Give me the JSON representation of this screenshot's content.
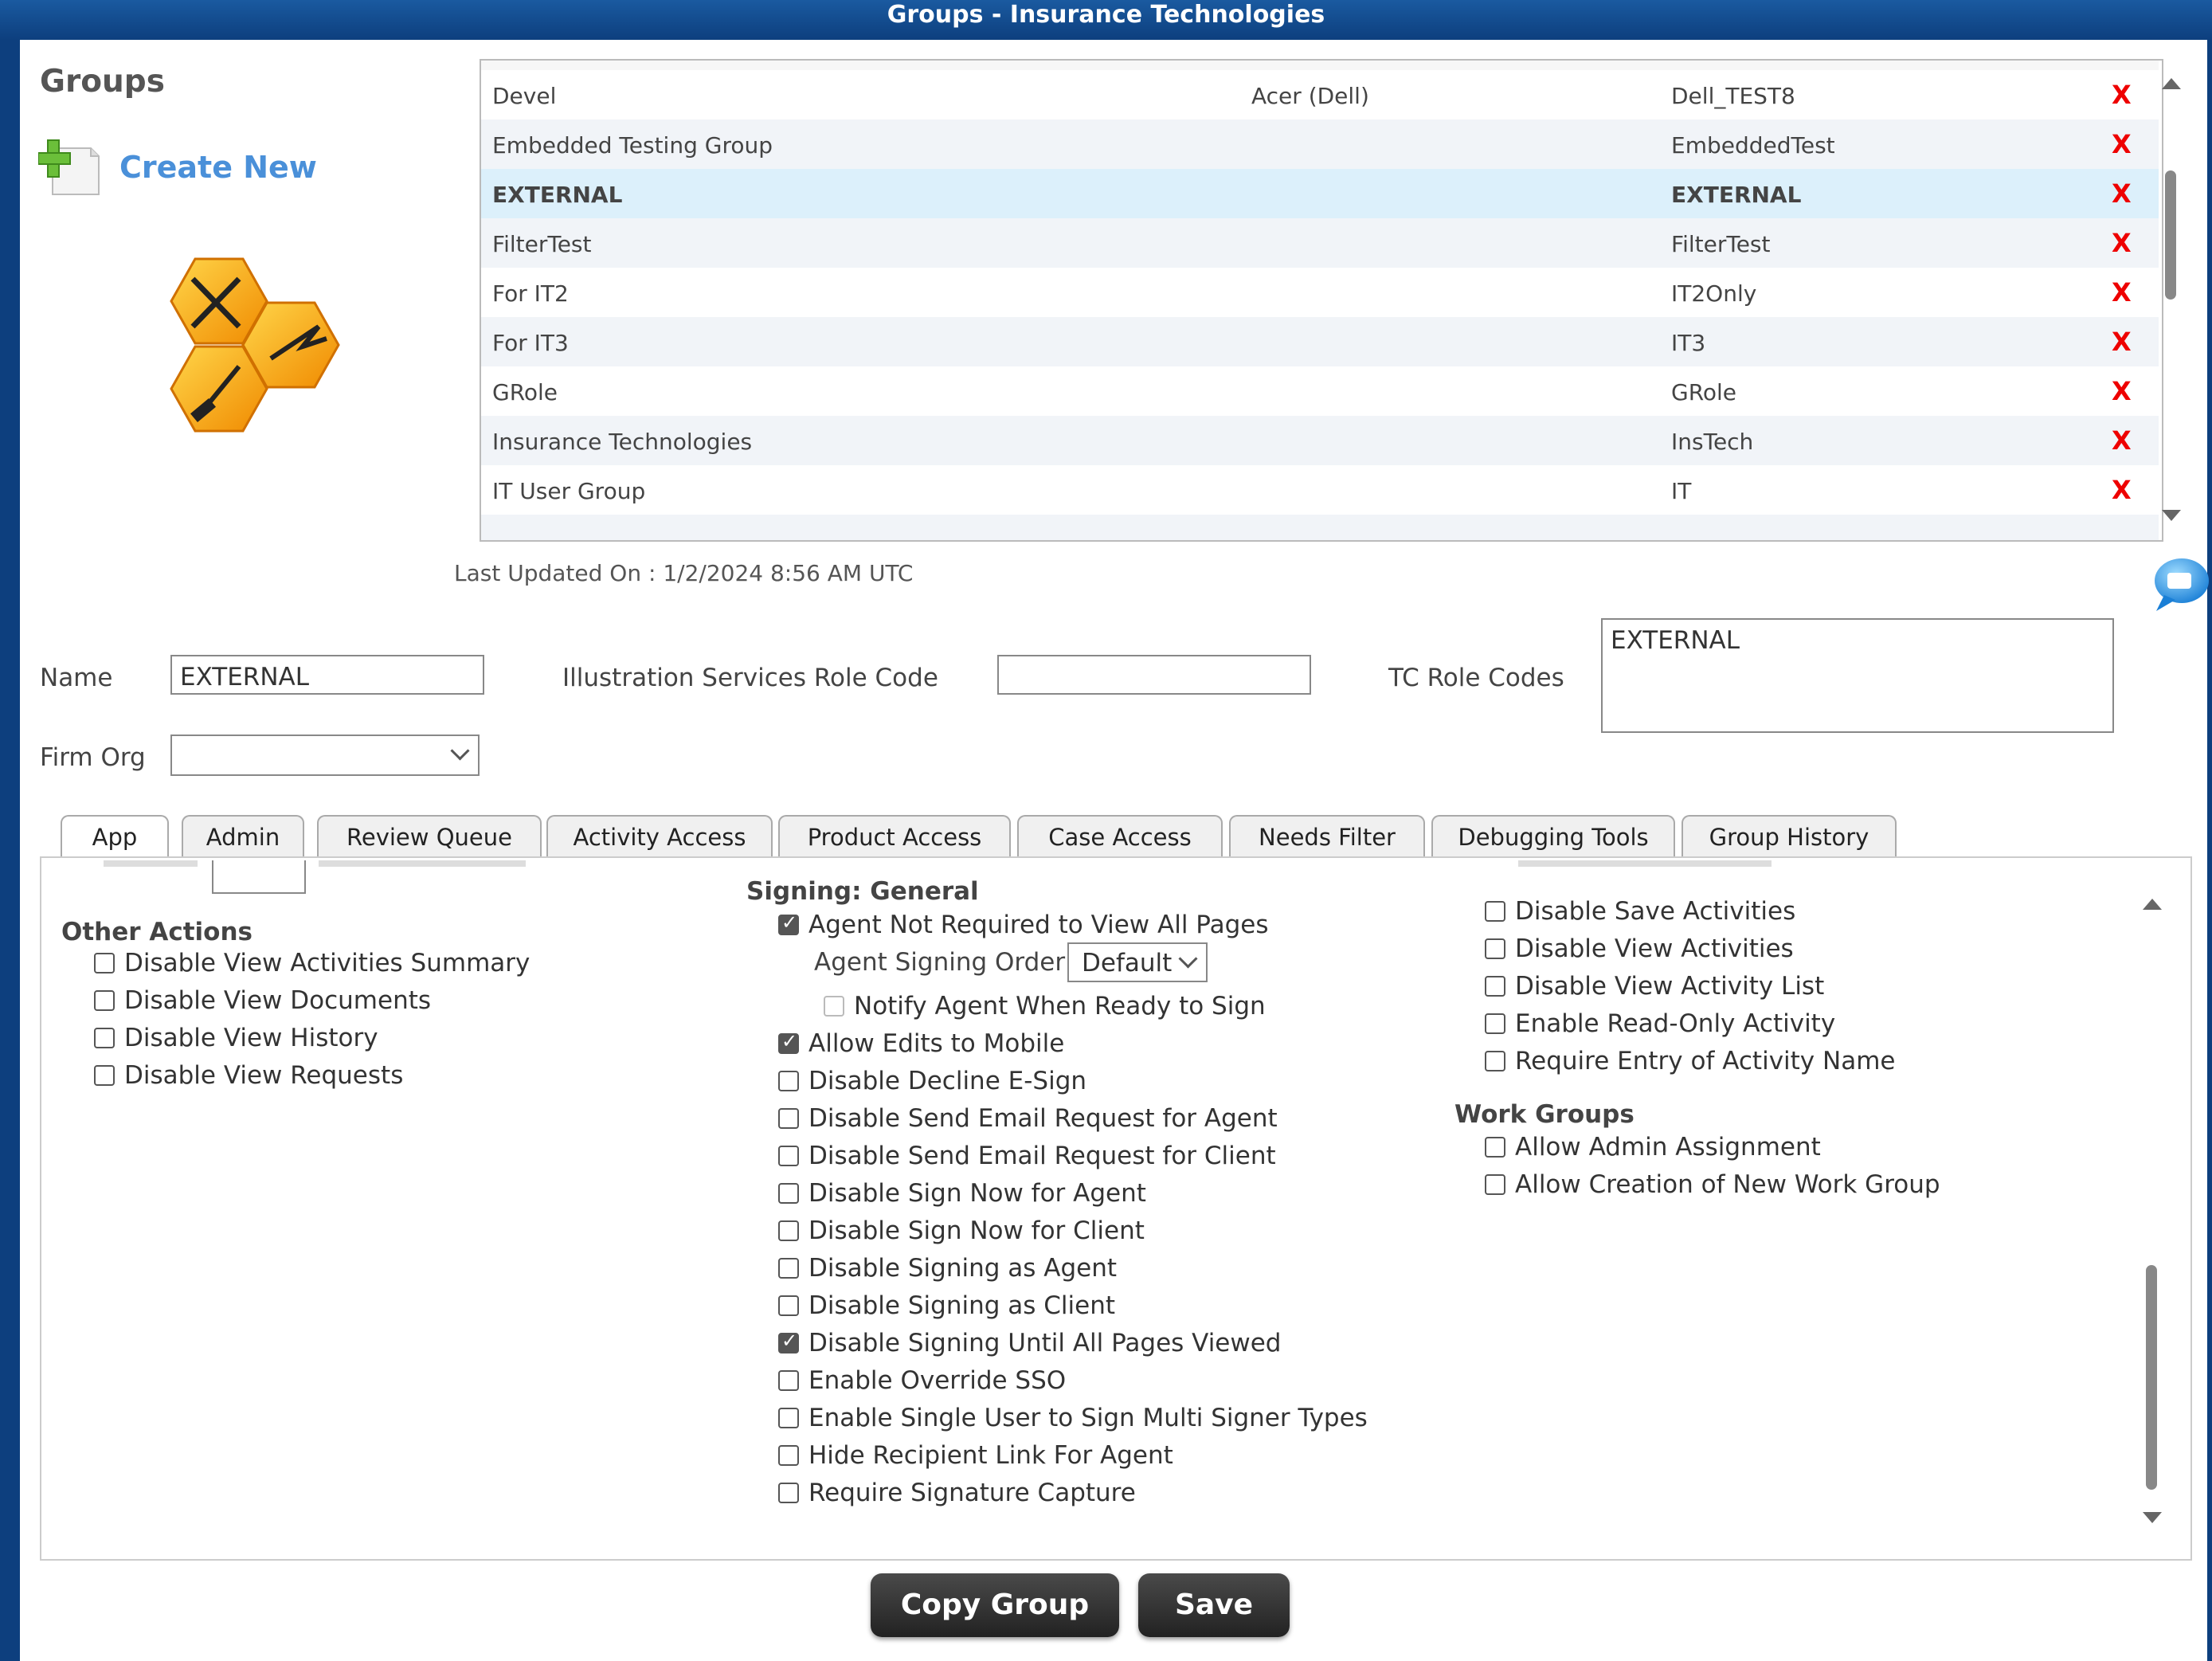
{
  "window": {
    "title": "Groups - Insurance Technologies"
  },
  "sidebar": {
    "heading": "Groups",
    "create_new_label": "Create New"
  },
  "groups_table": {
    "rows": [
      {
        "name": "Devel",
        "org": "Acer (Dell)",
        "code": "Dell_TEST8",
        "delete": "X"
      },
      {
        "name": "Embedded Testing Group",
        "org": "",
        "code": "EmbeddedTest",
        "delete": "X"
      },
      {
        "name": "EXTERNAL",
        "org": "",
        "code": "EXTERNAL",
        "delete": "X",
        "selected": true
      },
      {
        "name": "FilterTest",
        "org": "",
        "code": "FilterTest",
        "delete": "X"
      },
      {
        "name": "For IT2",
        "org": "",
        "code": "IT2Only",
        "delete": "X"
      },
      {
        "name": "For IT3",
        "org": "",
        "code": "IT3",
        "delete": "X"
      },
      {
        "name": "GRole",
        "org": "",
        "code": "GRole",
        "delete": "X"
      },
      {
        "name": "Insurance Technologies",
        "org": "",
        "code": "InsTech",
        "delete": "X"
      },
      {
        "name": "IT User Group",
        "org": "",
        "code": "IT",
        "delete": "X"
      }
    ]
  },
  "last_updated": "Last Updated On : 1/2/2024 8:56 AM UTC",
  "form": {
    "name_label": "Name",
    "name_value": "EXTERNAL",
    "illustration_label": "Illustration Services Role Code",
    "illustration_value": "",
    "tc_label": "TC Role Codes",
    "tc_value": "EXTERNAL",
    "firm_org_label": "Firm Org",
    "firm_org_value": ""
  },
  "tabs": [
    "App",
    "Admin",
    "Review Queue",
    "Activity Access",
    "Product Access",
    "Case Access",
    "Needs Filter",
    "Debugging Tools",
    "Group History"
  ],
  "active_tab": "App",
  "panel": {
    "other_actions": {
      "heading": "Other Actions",
      "items": [
        {
          "label": "Disable View Activities Summary",
          "checked": false
        },
        {
          "label": "Disable View Documents",
          "checked": false
        },
        {
          "label": "Disable View History",
          "checked": false
        },
        {
          "label": "Disable View Requests",
          "checked": false
        }
      ]
    },
    "signing_general": {
      "heading": "Signing: General",
      "agent_not_required": {
        "label": "Agent Not Required to View All Pages",
        "checked": true
      },
      "agent_signing_order_label": "Agent Signing Order",
      "agent_signing_order_value": "Default",
      "notify_agent": {
        "label": "Notify Agent When Ready to Sign",
        "checked": false
      },
      "items": [
        {
          "label": "Allow Edits to Mobile",
          "checked": true
        },
        {
          "label": "Disable Decline E-Sign",
          "checked": false
        },
        {
          "label": "Disable Send Email Request for Agent",
          "checked": false
        },
        {
          "label": "Disable Send Email Request for Client",
          "checked": false
        },
        {
          "label": "Disable Sign Now for Agent",
          "checked": false
        },
        {
          "label": "Disable Sign Now for Client",
          "checked": false
        },
        {
          "label": "Disable Signing as Agent",
          "checked": false
        },
        {
          "label": "Disable Signing as Client",
          "checked": false
        },
        {
          "label": "Disable Signing Until All Pages Viewed",
          "checked": true
        },
        {
          "label": "Enable Override SSO",
          "checked": false
        },
        {
          "label": "Enable Single User to Sign Multi Signer Types",
          "checked": false
        },
        {
          "label": "Hide Recipient Link For Agent",
          "checked": false
        },
        {
          "label": "Require Signature Capture",
          "checked": false
        }
      ]
    },
    "activities": {
      "items": [
        {
          "label": "Disable Save Activities",
          "checked": false
        },
        {
          "label": "Disable View Activities",
          "checked": false
        },
        {
          "label": "Disable View Activity List",
          "checked": false
        },
        {
          "label": "Enable Read-Only Activity",
          "checked": false
        },
        {
          "label": "Require Entry of Activity Name",
          "checked": false
        }
      ]
    },
    "work_groups": {
      "heading": "Work Groups",
      "items": [
        {
          "label": "Allow Admin Assignment",
          "checked": false
        },
        {
          "label": "Allow Creation of New Work Group",
          "checked": false
        }
      ]
    }
  },
  "buttons": {
    "copy_group": "Copy Group",
    "save": "Save"
  },
  "colors": {
    "title_bar": "#0d3f7e",
    "accent_link": "#4a90d9",
    "delete_x": "#e00000",
    "selected_row": "#dcf0fb"
  }
}
